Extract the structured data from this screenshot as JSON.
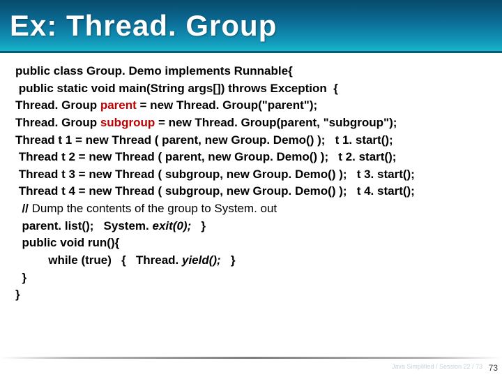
{
  "title": "Ex: Thread. Group",
  "code": {
    "l1": {
      "text": "public class Group. Demo implements Runnable{"
    },
    "l2": {
      "text": " public static void main(String args[]) throws Exception  {"
    },
    "l3a": "Thread. Group ",
    "l3b": "parent",
    "l3c": " = new Thread. Group(\"parent\");",
    "l4a": "Thread. Group ",
    "l4b": "subgroup",
    "l4c": " = new Thread. Group(parent, \"subgroup\");",
    "l5": "Thread t 1 = new Thread ( parent, new Group. Demo() );   t 1. start();",
    "l6": " Thread t 2 = new Thread ( parent, new Group. Demo() );   t 2. start();",
    "l7": " Thread t 3 = new Thread ( subgroup, new Group. Demo() );   t 3. start();",
    "l8": " Thread t 4 = new Thread ( subgroup, new Group. Demo() );   t 4. start();",
    "l9": "  // ",
    "l9b": "Dump the contents of the group to System. out",
    "l10a": "  parent. list();   System. ",
    "l10b": "exit(0);",
    "l10c": "   }",
    "l11": "  public void run(){",
    "l12a": "          while (true)   {   Thread. ",
    "l12b": "yield();",
    "l12c": "   }",
    "l13": "  }",
    "l14": "}"
  },
  "pageNumber": "73",
  "footerCredit": "Java Simplified / Session 22 / 73"
}
